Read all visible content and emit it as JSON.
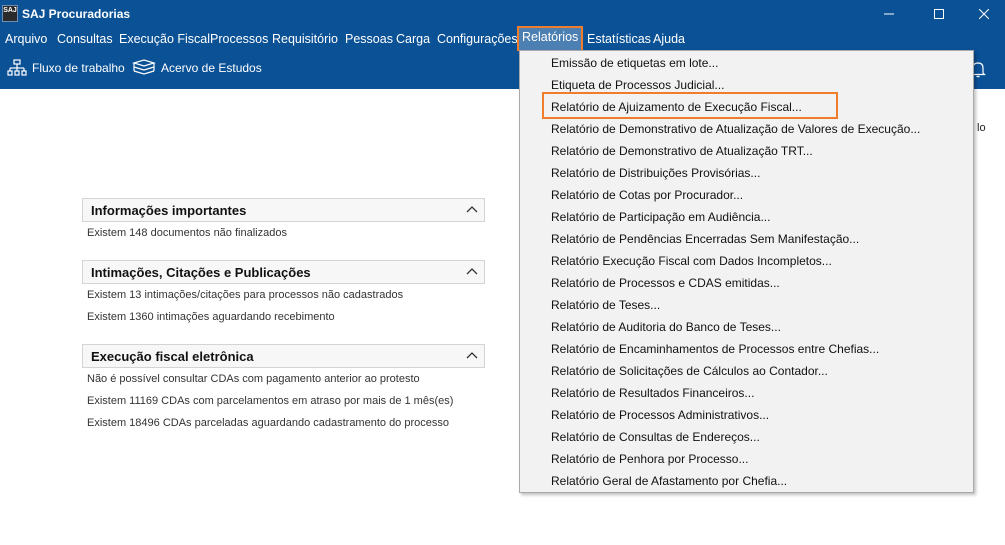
{
  "window": {
    "logo_text": "SAJ",
    "title": "SAJ Procuradorias"
  },
  "menubar": {
    "items": [
      "Arquivo",
      "Consultas",
      "Execução Fiscal",
      "Processos",
      "Requisitório",
      "Pessoas",
      "Carga",
      "Configurações",
      "Relatórios",
      "Estatísticas",
      "Ajuda"
    ],
    "active": "Relatórios"
  },
  "toolbar": {
    "workflow_label": "Fluxo de trabalho",
    "studies_label": "Acervo de Estudos"
  },
  "right_cut_text": "lo",
  "sections": [
    {
      "title": "Informações importantes",
      "lines": [
        "Existem  148 documentos não finalizados"
      ]
    },
    {
      "title": "Intimações, Citações e Publicações",
      "lines": [
        "Existem  13 intimações/citações para processos não cadastrados",
        "Existem  1360 intimações aguardando recebimento"
      ]
    },
    {
      "title": "Execução fiscal eletrônica",
      "lines": [
        "Não é possível consultar CDAs com pagamento anterior ao protesto",
        "Existem  11169 CDAs com parcelamentos em atraso por mais de 1 mês(es)",
        "Existem  18496 CDAs parceladas aguardando cadastramento do processo"
      ]
    }
  ],
  "dropdown": {
    "highlighted_index": 2,
    "items": [
      "Emissão de etiquetas em lote...",
      "Etiqueta de Processos Judicial...",
      "Relatório de Ajuizamento de Execução Fiscal...",
      "Relatório de Demonstrativo de Atualização de Valores de Execução...",
      "Relatório de Demonstrativo de Atualização TRT...",
      "Relatório de Distribuições Provisórias...",
      "Relatório de Cotas por Procurador...",
      "Relatório de Participação em Audiência...",
      "Relatório de Pendências Encerradas Sem Manifestação...",
      "Relatório Execução Fiscal com Dados Incompletos...",
      "Relatório de Processos e CDAS emitidas...",
      "Relatório de Teses...",
      "Relatório de Auditoria do Banco de Teses...",
      "Relatório de Encaminhamentos de Processos entre Chefias...",
      "Relatório de Solicitações de Cálculos ao Contador...",
      "Relatório de Resultados Financeiros...",
      "Relatório de Processos Administrativos...",
      "Relatório de Consultas de Endereços...",
      "Relatório de Penhora por Processo...",
      "Relatório Geral de Afastamento por Chefia..."
    ]
  },
  "colors": {
    "brand_blue": "#0b5196",
    "highlight_orange": "#f07d2b",
    "menu_active_bg": "#4c7fb2"
  }
}
